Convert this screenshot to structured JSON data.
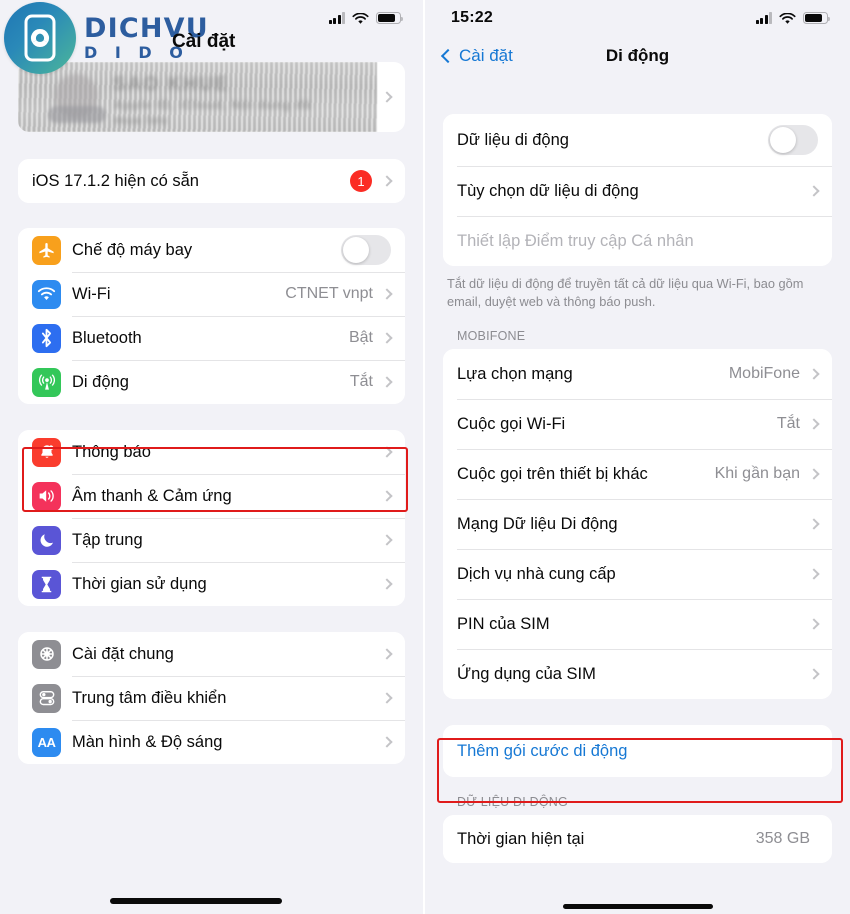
{
  "watermark": {
    "logo_line1": "DICHVU",
    "logo_line2": "D I D O",
    "logo_icon": "phone-swirl-logo-icon",
    "brand_color": "#2d5d9f"
  },
  "left_phone": {
    "status_bar": {
      "signal_icon": "signal-bars-icon",
      "wifi_icon": "wifi-icon",
      "battery_icon": "battery-icon"
    },
    "title": "Cài đặt",
    "apple_id_banner": {
      "blurred": true,
      "ghost_name": "SAO KHUE",
      "ghost_line2": "Apple ID, iCloud, Nội dung đã",
      "ghost_line3": "mua lưu",
      "chevron_icon": "chevron-right-icon"
    },
    "update_group": [
      {
        "label": "iOS 17.1.2 hiện có sẵn",
        "badge": "1",
        "chevron_icon": "chevron-right-icon"
      }
    ],
    "connectivity_group": [
      {
        "label": "Chế độ máy bay",
        "icon": "airplane-icon",
        "icon_color": "#f8a01c",
        "control": "toggle",
        "toggle_on": false
      },
      {
        "label": "Wi-Fi",
        "icon": "wifi-icon",
        "icon_color": "#2d8bf0",
        "value": "CTNET vnpt",
        "chevron_icon": "chevron-right-icon"
      },
      {
        "label": "Bluetooth",
        "icon": "bluetooth-icon",
        "icon_color": "#2d6ef0",
        "value": "Bật",
        "chevron_icon": "chevron-right-icon"
      },
      {
        "label": "Di động",
        "icon": "cellular-antenna-icon",
        "icon_color": "#33c759",
        "value": "Tắt",
        "chevron_icon": "chevron-right-icon",
        "highlighted": true
      }
    ],
    "alerts_group": [
      {
        "label": "Thông báo",
        "icon": "bell-icon",
        "icon_color": "#fa3c2d",
        "chevron_icon": "chevron-right-icon"
      },
      {
        "label": "Âm thanh & Cảm ứng",
        "icon": "speaker-icon",
        "icon_color": "#f4325b",
        "chevron_icon": "chevron-right-icon"
      },
      {
        "label": "Tập trung",
        "icon": "moon-icon",
        "icon_color": "#5a55d6",
        "chevron_icon": "chevron-right-icon"
      },
      {
        "label": "Thời gian sử dụng",
        "icon": "hourglass-icon",
        "icon_color": "#5a55d6",
        "chevron_icon": "chevron-right-icon"
      }
    ],
    "system_group": [
      {
        "label": "Cài đặt chung",
        "icon": "gear-icon",
        "icon_color": "#8e8e93",
        "chevron_icon": "chevron-right-icon"
      },
      {
        "label": "Trung tâm điều khiển",
        "icon": "control-center-icon",
        "icon_color": "#8e8e93",
        "chevron_icon": "chevron-right-icon"
      },
      {
        "label": "Màn hình & Độ sáng",
        "icon": "aa-display-icon",
        "icon_color": "#2d8bf0",
        "chevron_icon": "chevron-right-icon"
      }
    ],
    "highlight_color": "#e01b1b"
  },
  "right_phone": {
    "status_bar": {
      "time": "15:22",
      "signal_icon": "signal-bars-icon",
      "wifi_icon": "wifi-icon",
      "battery_icon": "battery-icon"
    },
    "nav": {
      "back_label": "Cài đặt",
      "back_icon": "chevron-left-icon",
      "title": "Di động"
    },
    "data_group": [
      {
        "label": "Dữ liệu di động",
        "control": "toggle",
        "toggle_on": false
      },
      {
        "label": "Tùy chọn dữ liệu di động",
        "chevron_icon": "chevron-right-icon"
      },
      {
        "label": "Thiết lập Điểm truy cập Cá nhân",
        "dim": true
      }
    ],
    "data_group_footer": "Tắt dữ liệu di động để truyền tất cả dữ liệu qua Wi-Fi, bao gồm email, duyệt web và thông báo push.",
    "carrier_header": "MOBIFONE",
    "carrier_group": [
      {
        "label": "Lựa chọn mạng",
        "value": "MobiFone",
        "chevron_icon": "chevron-right-icon"
      },
      {
        "label": "Cuộc gọi Wi-Fi",
        "value": "Tắt",
        "chevron_icon": "chevron-right-icon"
      },
      {
        "label": "Cuộc gọi trên thiết bị khác",
        "value": "Khi gần bạn",
        "chevron_icon": "chevron-right-icon"
      },
      {
        "label": "Mạng Dữ liệu Di động",
        "chevron_icon": "chevron-right-icon"
      },
      {
        "label": "Dịch vụ nhà cung cấp",
        "chevron_icon": "chevron-right-icon"
      },
      {
        "label": "PIN của SIM",
        "chevron_icon": "chevron-right-icon"
      },
      {
        "label": "Ứng dụng của SIM",
        "chevron_icon": "chevron-right-icon"
      }
    ],
    "add_plan_group": [
      {
        "label": "Thêm gói cước di động",
        "link": true,
        "highlighted": true
      }
    ],
    "usage_header": "DỮ LIỆU DI ĐỘNG",
    "usage_group": [
      {
        "label": "Thời gian hiện tại",
        "value": "358 GB"
      }
    ],
    "highlight_color": "#e01b1b"
  }
}
